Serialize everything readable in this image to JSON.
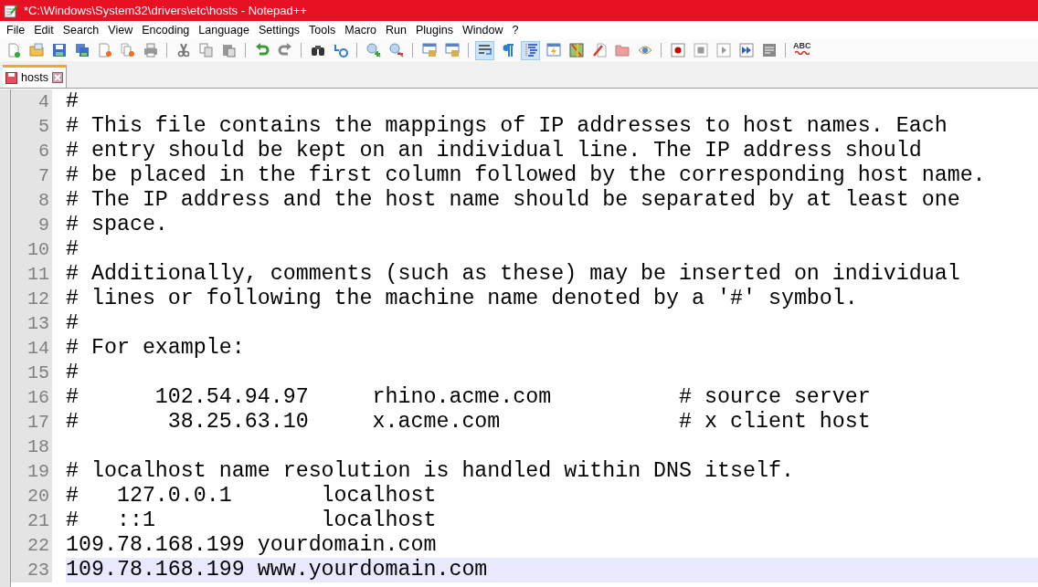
{
  "window": {
    "title": "*C:\\Windows\\System32\\drivers\\etc\\hosts - Notepad++"
  },
  "menu": [
    "File",
    "Edit",
    "Search",
    "View",
    "Encoding",
    "Language",
    "Settings",
    "Tools",
    "Macro",
    "Run",
    "Plugins",
    "Window",
    "?"
  ],
  "toolbar": [
    {
      "kind": "new"
    },
    {
      "kind": "open"
    },
    {
      "kind": "save"
    },
    {
      "kind": "save-all"
    },
    {
      "kind": "close"
    },
    {
      "kind": "close-all"
    },
    {
      "kind": "print"
    },
    {
      "kind": "sep"
    },
    {
      "kind": "cut"
    },
    {
      "kind": "copy"
    },
    {
      "kind": "paste"
    },
    {
      "kind": "sep"
    },
    {
      "kind": "undo"
    },
    {
      "kind": "redo"
    },
    {
      "kind": "sep"
    },
    {
      "kind": "find"
    },
    {
      "kind": "replace"
    },
    {
      "kind": "sep"
    },
    {
      "kind": "zoom-in"
    },
    {
      "kind": "zoom-out"
    },
    {
      "kind": "sep"
    },
    {
      "kind": "sync"
    },
    {
      "kind": "sync"
    },
    {
      "kind": "sep"
    },
    {
      "kind": "wrap",
      "pressed": true
    },
    {
      "kind": "pilcrow",
      "pressed": false
    },
    {
      "kind": "indent",
      "pressed": true
    },
    {
      "kind": "lightning"
    },
    {
      "kind": "map"
    },
    {
      "kind": "pen"
    },
    {
      "kind": "folder"
    },
    {
      "kind": "eye"
    },
    {
      "kind": "sep"
    },
    {
      "kind": "record"
    },
    {
      "kind": "stop"
    },
    {
      "kind": "play"
    },
    {
      "kind": "fast"
    },
    {
      "kind": "save-macro"
    },
    {
      "kind": "sep"
    },
    {
      "kind": "spell",
      "text": "ABC"
    }
  ],
  "tabs": [
    {
      "label": "hosts",
      "selected": true
    }
  ],
  "lines": [
    {
      "number": "4",
      "text": "#",
      "current": false
    },
    {
      "number": "5",
      "text": "# This file contains the mappings of IP addresses to host names. Each",
      "current": false
    },
    {
      "number": "6",
      "text": "# entry should be kept on an individual line. The IP address should",
      "current": false
    },
    {
      "number": "7",
      "text": "# be placed in the first column followed by the corresponding host name.",
      "current": false
    },
    {
      "number": "8",
      "text": "# The IP address and the host name should be separated by at least one",
      "current": false
    },
    {
      "number": "9",
      "text": "# space.",
      "current": false
    },
    {
      "number": "10",
      "text": "#",
      "current": false
    },
    {
      "number": "11",
      "text": "# Additionally, comments (such as these) may be inserted on individual",
      "current": false
    },
    {
      "number": "12",
      "text": "# lines or following the machine name denoted by a '#' symbol.",
      "current": false
    },
    {
      "number": "13",
      "text": "#",
      "current": false
    },
    {
      "number": "14",
      "text": "# For example:",
      "current": false
    },
    {
      "number": "15",
      "text": "#",
      "current": false
    },
    {
      "number": "16",
      "text": "#      102.54.94.97     rhino.acme.com          # source server",
      "current": false
    },
    {
      "number": "17",
      "text": "#       38.25.63.10     x.acme.com              # x client host",
      "current": false
    },
    {
      "number": "18"
    },
    {
      "number": "19",
      "text": "# localhost name resolution is handled within DNS itself.",
      "current": false
    },
    {
      "number": "20",
      "text": "#   127.0.0.1       localhost",
      "current": false
    },
    {
      "number": "21",
      "text": "#   ::1             localhost",
      "current": false
    },
    {
      "number": "22",
      "text": "109.78.168.199 yourdomain.com",
      "current": false
    },
    {
      "number": "23",
      "text": "109.78.168.199 www.yourdomain.com",
      "current": true
    }
  ]
}
